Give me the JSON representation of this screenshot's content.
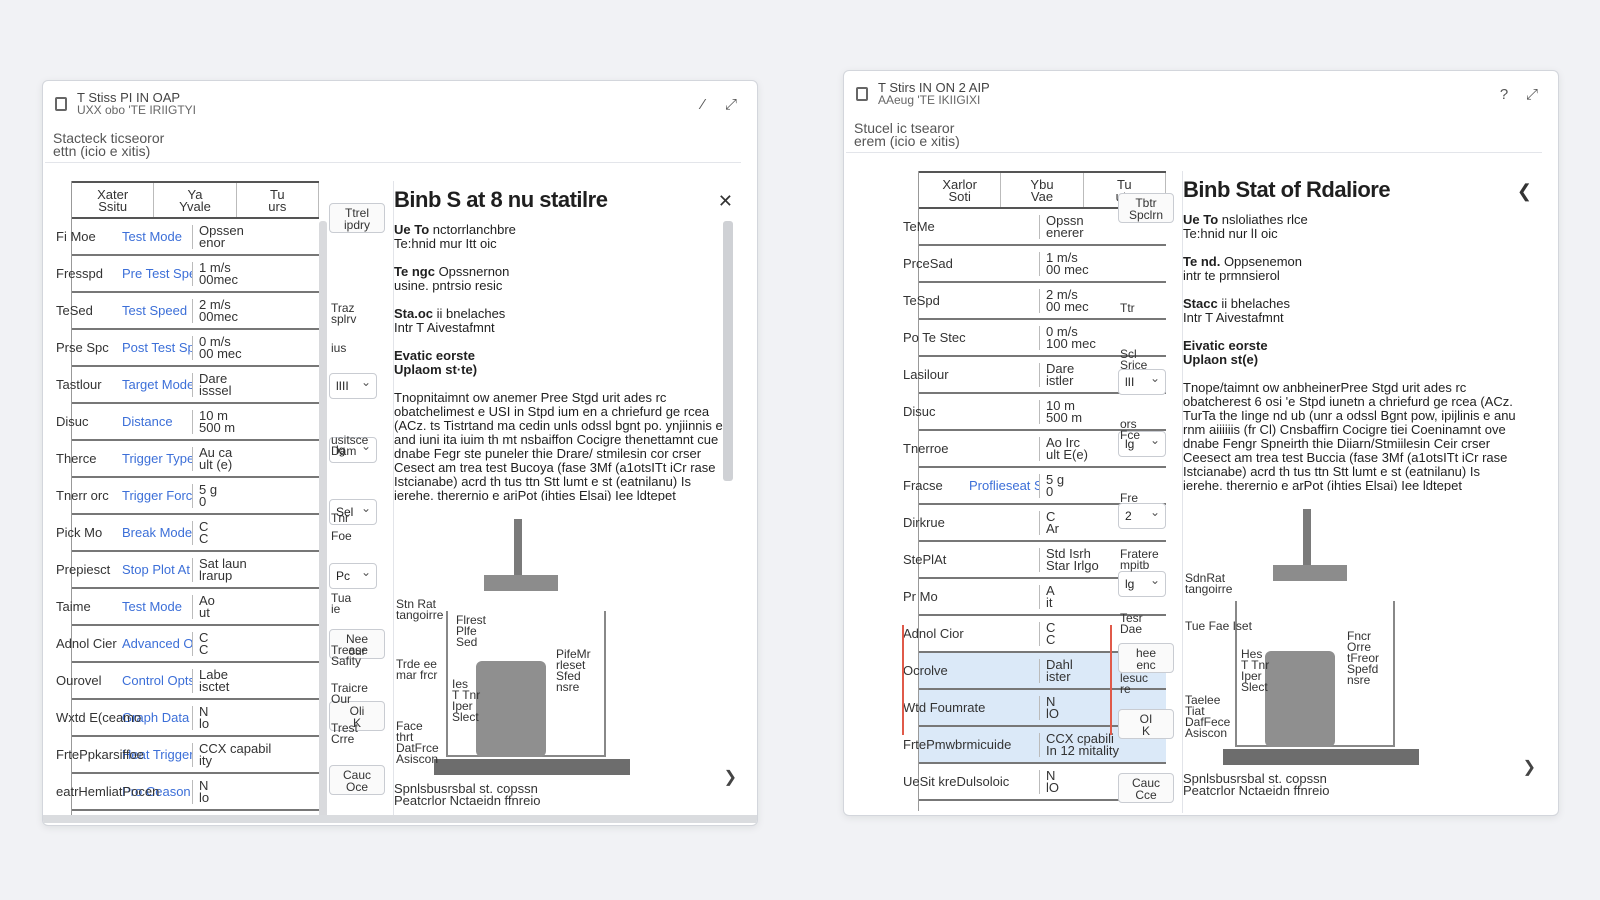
{
  "window_left": {
    "title": "T Stiss PI IN OAP",
    "subtitle": "UXX obo 'TE IRIIGTYI",
    "search_placeholder": "Stacteck ticseoror\nettn (icio e xitis)",
    "table_headers": [
      "Xater\nSsitu",
      "Ya\nYvale",
      "Tu\nurs"
    ],
    "side_labels": [
      "Fi Moe",
      "Fresspd",
      "TeSed",
      "Prse Spc",
      "Tastlour",
      "Disuc",
      "Therce",
      "Tnerr orc",
      "Pick Mo",
      "Prepiesct",
      "Taime",
      "Adnol Cier",
      "Ourovel",
      "Wxtd E(ceamo",
      "FrtePpkarsiffoe",
      "eatrHemliatPocen"
    ],
    "rows": [
      {
        "link": "Test Mode",
        "value": "Opssen\nenor"
      },
      {
        "link": "Pre Test Speed",
        "value": "1 m/s\n00mec"
      },
      {
        "link": "Test Speed",
        "value": "2 m/s\n00mec"
      },
      {
        "link": "Post Test Speed",
        "value": "0 m/s\n00 mec"
      },
      {
        "link": "Target Mode",
        "value": "Dare\nisssel"
      },
      {
        "link": "Distance",
        "value": "10 m\n500 m"
      },
      {
        "link": "Trigger Type",
        "value": "Au ca\nult (e)"
      },
      {
        "link": "Trigger Force",
        "value": "5 g\n0"
      },
      {
        "link": "Break Mode",
        "value": "C\nC"
      },
      {
        "link": "Stop Plot At",
        "value": "Sat laun\nlrarup"
      },
      {
        "link": "Test Mode",
        "value": "Ao\nut"
      },
      {
        "link": "Advanced Opt",
        "value": "C\nC"
      },
      {
        "link": "Control Opts",
        "value": "Labe\nisctet"
      },
      {
        "link": "Graph Data Tempo",
        "value": "N\nlo"
      },
      {
        "link": "Heat Trigger",
        "value": "CCX capabil\nity"
      },
      {
        "link": "Pro Ceason Dela",
        "value": "N\nlo"
      }
    ],
    "mid_labels": [
      "Traz\nsplrv",
      "ius",
      "usitsce\nDam",
      "Tnr",
      "Foe",
      "Tua\nie",
      "Trease\nSafity",
      "Traicre\nOur",
      "Trest\nCrre"
    ],
    "mid_buttons": [
      "Ttrel\nipdry",
      "lIII",
      "lg",
      "Sel",
      "Pc",
      "Nee\nour",
      "Oli\nK",
      "Cauc\nOce"
    ],
    "panel": {
      "heading": "Binb S at 8 nu statilre",
      "p1_bold": "Ue To",
      "p1_text": "nctorrlanchbre\nTe:hnid mur Itt oic",
      "p2_bold": "Te ngc",
      "p2_text": "Opssnernon\nusine. pntrsio resic",
      "p3_bold": "Sta.oc",
      "p3_text": "ii bnelaches\nIntr T Aivestafmnt",
      "section": "Evatic eorste\nUplaom st·te)",
      "long": "Tnopnitaimnt ow anemer Pree Stgd urit ades rc obatchelimest e USI in Stpd ium en a chriefurd ge rcea (ACz. ts Tistrtand ma cedin unls odssl bgnt po. ynjiinnis e and iuni ita iuim th mt nsbaiffon Cocigre thenettamnt cue dnabe Fegr ste puneler thie Drare/ stmilesin cor crser Cesect am trea test Bucoya (fase 3Mf (a1otsITt iCr rase Istcianabe) acrd th tus ttn Stt lumt e st (eatnilanu) Is ierehe. therernio e ariPot (ihties Elsai) Iee ldtepet",
      "diagram_labels": [
        "Stn Rat\ntangoirre",
        "Flrest\nPlfe\nSed",
        "Trde ee\nmar frcr",
        "Ies\nT Tnr\nIper\nSlect",
        "PifeMr\nrleset\nSfed\nnsre",
        "Face\nthrt\nDatFrce\nAsiscon"
      ],
      "caption": "Spnlsbusrsbal st. copssn\nPeatcrlor Nctaeidn ffnreio"
    }
  },
  "window_right": {
    "title": "T Stirs IN ON 2 AIP",
    "subtitle": "AAeug 'TE IKIIGIXI",
    "search_placeholder": "Stucel ic tsearor\nerem (icio e xitis)",
    "table_headers": [
      "Xarlor\nSoti",
      "Ybu\nVae",
      "Tu\nuts"
    ],
    "side_labels": [
      "TeMe",
      "PrceSad",
      "TeSpd",
      "Po Te Stec",
      "Lasilour",
      "Disuc",
      "Tnerroe",
      "Fracse",
      "Dirkrue",
      "StePlAt",
      "Pr Mo",
      "Adnol Cior",
      "Ocrolve",
      "Wtd Foumrate",
      "FrtePmwbrmicuide",
      "UeSit kreDulsoloic"
    ],
    "rows": [
      {
        "link": "",
        "value": "Opssn\nenerer"
      },
      {
        "link": "",
        "value": "1 m/s\n00 mec"
      },
      {
        "link": "",
        "value": "2 m/s\n00 mec"
      },
      {
        "link": "",
        "value": "0 m/s\n100 mec"
      },
      {
        "link": "",
        "value": "Dare\nistler"
      },
      {
        "link": "",
        "value": "10 m\n500 m"
      },
      {
        "link": "",
        "value": "Ao Irc\nult E(e)"
      },
      {
        "link": "Proflieseat Speed",
        "value": "5 g\n0"
      },
      {
        "link": "",
        "value": "C\nAr"
      },
      {
        "link": "",
        "value": "Std Isrh\nStar Irlgo"
      },
      {
        "link": "",
        "value": "A\nit"
      },
      {
        "link": "",
        "value": "C\nC"
      },
      {
        "link": "",
        "value": "Dahl\nister"
      },
      {
        "link": "",
        "value": "N\nlO"
      },
      {
        "link": "",
        "value": "CCX cpabili\nIn 12 mitality"
      },
      {
        "link": "",
        "value": "N\nlO"
      }
    ],
    "mid_labels": [
      "Ttr",
      "Scl\nSrice",
      "ors\nFce",
      "Fre",
      "Fratere\nmpitb",
      "Tesr\nDae",
      "lesuc\nre"
    ],
    "mid_buttons": [
      "Tbtr\nSpclrn",
      "lII",
      "lg",
      "2",
      "lg",
      "hee\nenc",
      "OI\nK",
      "Cauc\nCce"
    ],
    "panel": {
      "heading": "Binb Stat of Rdaliore",
      "p1_bold": "Ue To",
      "p1_text": "nsloliathes rlce\nTe:hnid nur lI oic",
      "p2_bold": "Te nd.",
      "p2_text": "Oppsenemon\nintr te prmnsierol",
      "p3_bold": "Stacc",
      "p3_text": "ii bhelaches\nIntr T Aivestafmnt",
      "section": "Eivatic eorste\nUplaon st(e)",
      "long": "Tnope/taimnt ow anbheinerPree Stgd urit ades rc obatcherest 6 osi 'e Stpd iunetn a chriefurd ge rcea (ACz. TurTa the Iinge nd ub (unr a odssl Bgnt pow, ipijlinis e anu rnm aiiiiiis (fr Cl) Cnsbaffirn Cocigre tiei Coeninamnt ove dnabe Fengr Spneirth thie Diiarn/Stmiilesin Ceir crser Ceesect am trea test Buccia (fase 3Mf (a1otsITt iCr rase Istcianabe) acrd th tus ttn Stt lumt e st (eatnilanu) Is ierehe. therernio e arPot (ihties Elsai) Iee ldtepet",
      "diagram_labels": [
        "SdnRat\ntangoirre",
        "Tue Fae Iset",
        "Hes\nT Tnr\nIper\nSlect",
        "Fncr\nOrre\ntFreor\nSpefd\nnsre",
        "Taelee\nTiat\nDafFece\nAsiscon"
      ],
      "caption": "Spnlsbusrsbal st. copssn\nPeatcrlor Nctaeidn ffnreio"
    }
  },
  "colors": {
    "link": "#3c6fd8",
    "selected_row": "#dbe9f8",
    "accent": "#e05a4a"
  }
}
